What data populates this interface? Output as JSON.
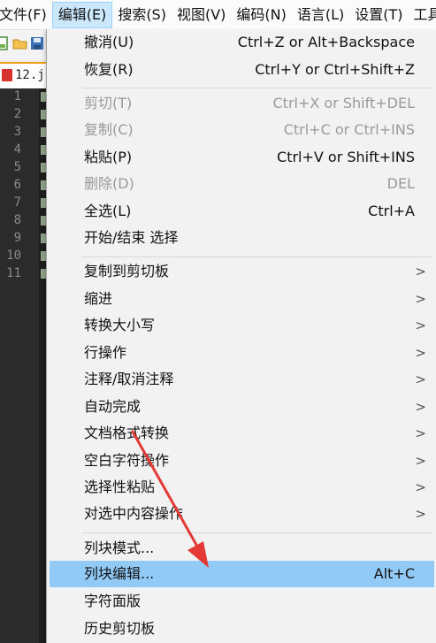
{
  "menubar": {
    "items": [
      {
        "label": "文件(F)",
        "active": false
      },
      {
        "label": "编辑(E)",
        "active": true
      },
      {
        "label": "搜索(S)",
        "active": false
      },
      {
        "label": "视图(V)",
        "active": false
      },
      {
        "label": "编码(N)",
        "active": false
      },
      {
        "label": "语言(L)",
        "active": false
      },
      {
        "label": "设置(T)",
        "active": false
      },
      {
        "label": "工具",
        "active": false
      }
    ]
  },
  "tab": {
    "label": "12.j"
  },
  "gutter": {
    "lines": [
      "1",
      "2",
      "3",
      "4",
      "5",
      "6",
      "7",
      "8",
      "9",
      "10",
      "11"
    ]
  },
  "edit_menu": {
    "items": [
      {
        "label": "撤消(U)",
        "shortcut": "Ctrl+Z or Alt+Backspace",
        "enabled": true,
        "submenu": false
      },
      {
        "label": "恢复(R)",
        "shortcut": "Ctrl+Y or Ctrl+Shift+Z",
        "enabled": true,
        "submenu": false
      },
      {
        "label": "剪切(T)",
        "shortcut": "Ctrl+X or Shift+DEL",
        "enabled": false,
        "submenu": false
      },
      {
        "label": "复制(C)",
        "shortcut": "Ctrl+C or Ctrl+INS",
        "enabled": false,
        "submenu": false
      },
      {
        "label": "粘贴(P)",
        "shortcut": "Ctrl+V or Shift+INS",
        "enabled": true,
        "submenu": false
      },
      {
        "label": "删除(D)",
        "shortcut": "DEL",
        "enabled": false,
        "submenu": false
      },
      {
        "label": "全选(L)",
        "shortcut": "Ctrl+A",
        "enabled": true,
        "submenu": false
      },
      {
        "label": "开始/结束 选择",
        "shortcut": "",
        "enabled": true,
        "submenu": false
      },
      {
        "label": "复制到剪切板",
        "shortcut": "",
        "enabled": true,
        "submenu": true
      },
      {
        "label": "缩进",
        "shortcut": "",
        "enabled": true,
        "submenu": true
      },
      {
        "label": "转换大小写",
        "shortcut": "",
        "enabled": true,
        "submenu": true
      },
      {
        "label": "行操作",
        "shortcut": "",
        "enabled": true,
        "submenu": true
      },
      {
        "label": "注释/取消注释",
        "shortcut": "",
        "enabled": true,
        "submenu": true
      },
      {
        "label": "自动完成",
        "shortcut": "",
        "enabled": true,
        "submenu": true
      },
      {
        "label": "文档格式转换",
        "shortcut": "",
        "enabled": true,
        "submenu": true
      },
      {
        "label": "空白字符操作",
        "shortcut": "",
        "enabled": true,
        "submenu": true
      },
      {
        "label": "选择性粘贴",
        "shortcut": "",
        "enabled": true,
        "submenu": true
      },
      {
        "label": "对选中内容操作",
        "shortcut": "",
        "enabled": true,
        "submenu": true
      },
      {
        "label": "列块模式...",
        "shortcut": "",
        "enabled": true,
        "submenu": false
      },
      {
        "label": "列块编辑...",
        "shortcut": "Alt+C",
        "enabled": true,
        "submenu": false,
        "highlighted": true
      },
      {
        "label": "字符面版",
        "shortcut": "",
        "enabled": true,
        "submenu": false
      },
      {
        "label": "历史剪切板",
        "shortcut": "",
        "enabled": true,
        "submenu": false
      }
    ],
    "submenu_arrow": ">"
  },
  "colors": {
    "menu_highlight": "#91c9f7",
    "active_menubar": "#cce8ff",
    "annotation_arrow": "#e53935",
    "editor_bg": "#1e1e1e"
  }
}
